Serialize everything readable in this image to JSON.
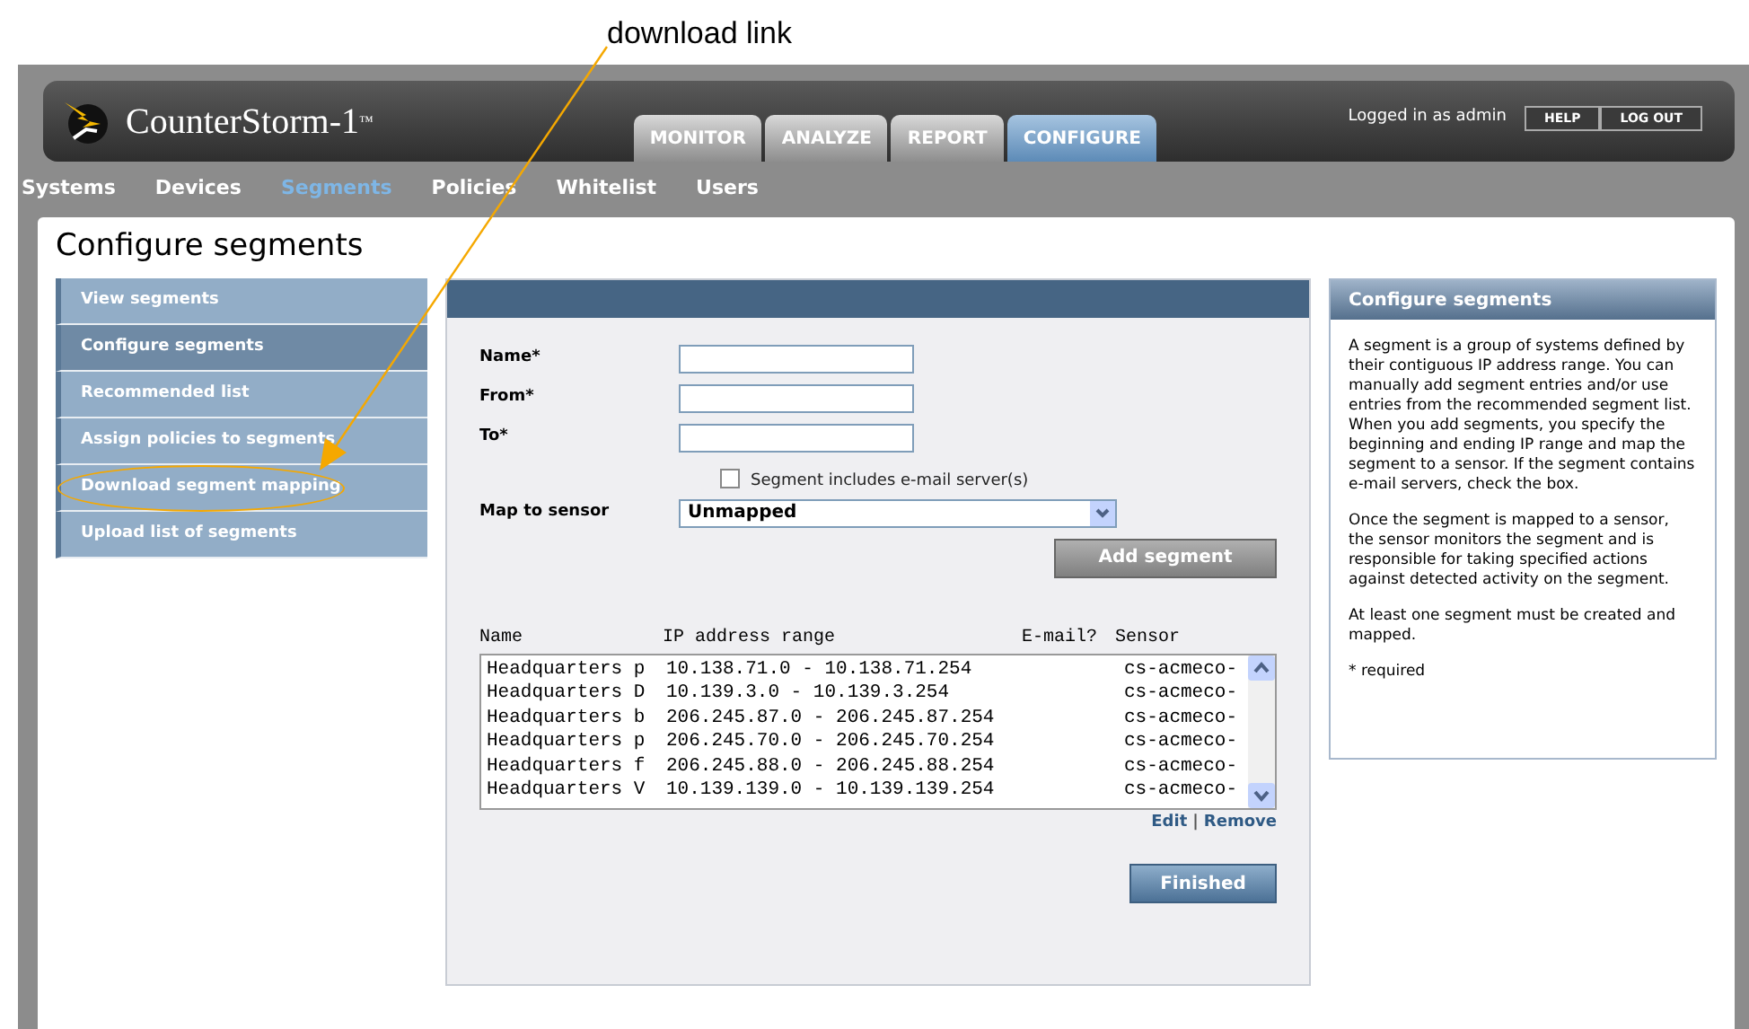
{
  "annotation": {
    "label": "download link"
  },
  "header": {
    "product": "CounterStorm-1",
    "trademark": "™",
    "login_text": "Logged in as admin",
    "buttons": [
      "HELP",
      "LOG OUT"
    ]
  },
  "tabs": [
    {
      "label": "MONITOR",
      "selected": false
    },
    {
      "label": "ANALYZE",
      "selected": false
    },
    {
      "label": "REPORT",
      "selected": false
    },
    {
      "label": "CONFIGURE",
      "selected": true
    }
  ],
  "subnav": [
    {
      "label": "Systems",
      "selected": false
    },
    {
      "label": "Devices",
      "selected": false
    },
    {
      "label": "Segments",
      "selected": true
    },
    {
      "label": "Policies",
      "selected": false
    },
    {
      "label": "Whitelist",
      "selected": false
    },
    {
      "label": "Users",
      "selected": false
    }
  ],
  "page_title": "Configure segments",
  "sidebar": {
    "items": [
      {
        "label": "View segments",
        "selected": false,
        "highlighted": false
      },
      {
        "label": "Configure segments",
        "selected": true,
        "highlighted": false
      },
      {
        "label": "Recommended list",
        "selected": false,
        "highlighted": false
      },
      {
        "label": "Assign policies to segments",
        "selected": false,
        "highlighted": false
      },
      {
        "label": "Download segment mapping",
        "selected": false,
        "highlighted": true
      },
      {
        "label": "Upload list of segments",
        "selected": false,
        "highlighted": false
      }
    ]
  },
  "form": {
    "fields": [
      {
        "label": "Name*"
      },
      {
        "label": "From*"
      },
      {
        "label": "To*"
      }
    ],
    "checkbox": {
      "label": "Segment includes e-mail server(s)",
      "checked": false
    },
    "sensor": {
      "label": "Map to sensor",
      "value": "Unmapped"
    },
    "add_button": "Add segment"
  },
  "segments": {
    "columns": [
      "Name",
      "IP address range",
      "E-mail?",
      "Sensor"
    ],
    "rows": [
      {
        "name": "Headquarters p",
        "range": "10.138.71.0 - 10.138.71.254",
        "sensor": "cs-acmeco-"
      },
      {
        "name": "Headquarters D",
        "range": "10.139.3.0 - 10.139.3.254",
        "sensor": "cs-acmeco-"
      },
      {
        "name": "Headquarters b",
        "range": "206.245.87.0 - 206.245.87.254",
        "sensor": "cs-acmeco-"
      },
      {
        "name": "Headquarters p",
        "range": "206.245.70.0 - 206.245.70.254",
        "sensor": "cs-acmeco-"
      },
      {
        "name": "Headquarters f",
        "range": "206.245.88.0 - 206.245.88.254",
        "sensor": "cs-acmeco-"
      },
      {
        "name": "Headquarters V",
        "range": "10.139.139.0 - 10.139.139.254",
        "sensor": "cs-acmeco-"
      }
    ],
    "actions": [
      "Edit",
      "Remove"
    ],
    "action_separator": "|",
    "finish_button": "Finished"
  },
  "help_panel": {
    "title": "Configure segments",
    "paragraphs": [
      "A segment is a group of systems defined by their contiguous IP address range. You can manually add segment entries and/or use entries from the recommended segment list. When you add segments, you specify the beginning and ending IP range and map the segment to a sensor. If the segment contains e-mail servers, check the box.",
      "Once the segment is mapped to a sensor, the sensor monitors the segment and is responsible for taking specified actions against detected activity on the segment.",
      "At least one segment must be created and mapped.",
      "* required"
    ]
  }
}
